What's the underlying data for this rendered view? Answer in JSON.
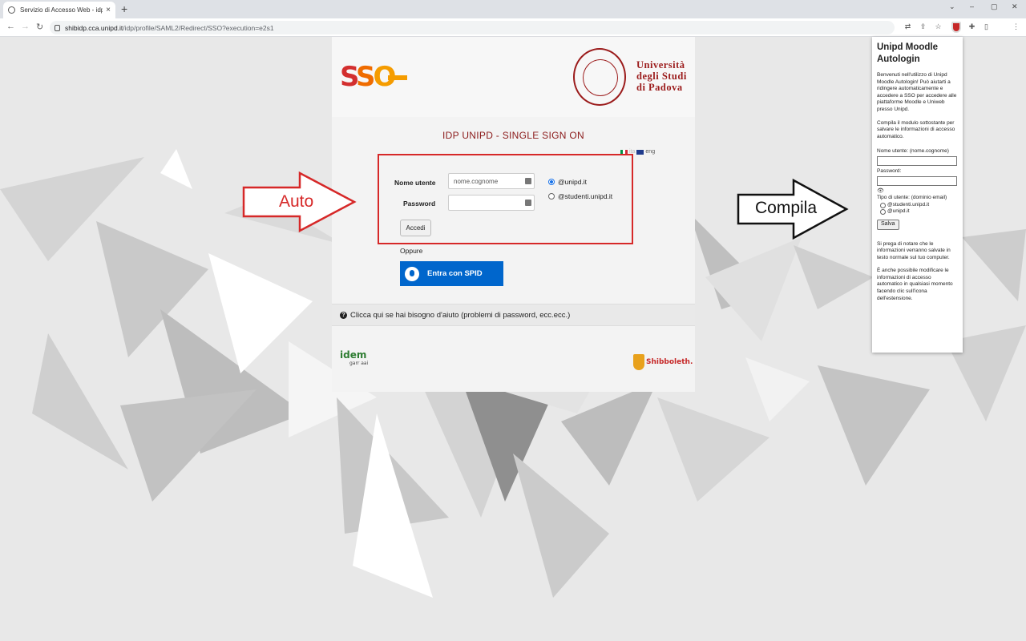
{
  "browser": {
    "tab_title": "Servizio di Accesso Web - idp",
    "tab_close": "×",
    "new_tab": "+",
    "window_controls": [
      "⌄",
      "–",
      "▢",
      "✕"
    ],
    "url_host": "shibidp.cca.unipd.it",
    "url_path": "/idp/profile/SAML2/Redirect/SSO?execution=e2s1"
  },
  "login": {
    "logo_sso": "SSO",
    "university_name": [
      "Università",
      "degli Studi",
      "di Padova"
    ],
    "title": "IDP UNIPD - SINGLE SIGN ON",
    "lang_it": "ita",
    "lang_en": "eng",
    "username_label": "Nome utente",
    "username_placeholder": "nome.cognome",
    "password_label": "Password",
    "domain_options": [
      "@unipd.it",
      "@studenti.unipd.it"
    ],
    "domain_selected": "@unipd.it",
    "submit_label": "Accedi",
    "or_label": "Oppure",
    "spid_label": "Entra con SPID",
    "help_text": "Clicca qui se hai bisogno d'aiuto (problemi di password, ecc.ecc.)",
    "idem_logo": "idem",
    "idem_sub": "garr aai",
    "shibboleth_logo": "Shibboleth."
  },
  "annotations": {
    "left_arrow_label": "Auto",
    "right_arrow_label": "Compila",
    "highlight_color": "#d62828"
  },
  "popup": {
    "title": "Unipd Moodle Autologin",
    "intro": "Benvenuti nell'utilizzo di Unipd Moodle Autologin! Può aiutarti a ridingere automaticamente e accedere a SSO per accedere alle piattaforme Moodle e Uniweb presso Unipd.",
    "instructions": "Compila il modulo sottostante per salvare le informazioni di accesso automatico.",
    "username_label": "Nome utente: (nome.cognome)",
    "password_label": "Password:",
    "eye_icon": "👁",
    "user_type_label": "Tipo di utente: (dominio email)",
    "user_type_options": [
      "@studenti.unipd.it",
      "@unipd.it"
    ],
    "save_label": "Salva",
    "note": "Si prega di notare che le informazioni verranno salvate in testo normale sul tuo computer.",
    "note2": "È anche possibile modificare le informazioni di accesso automatico in qualsiasi momento facendo clic sull'icona dell'estensione."
  }
}
